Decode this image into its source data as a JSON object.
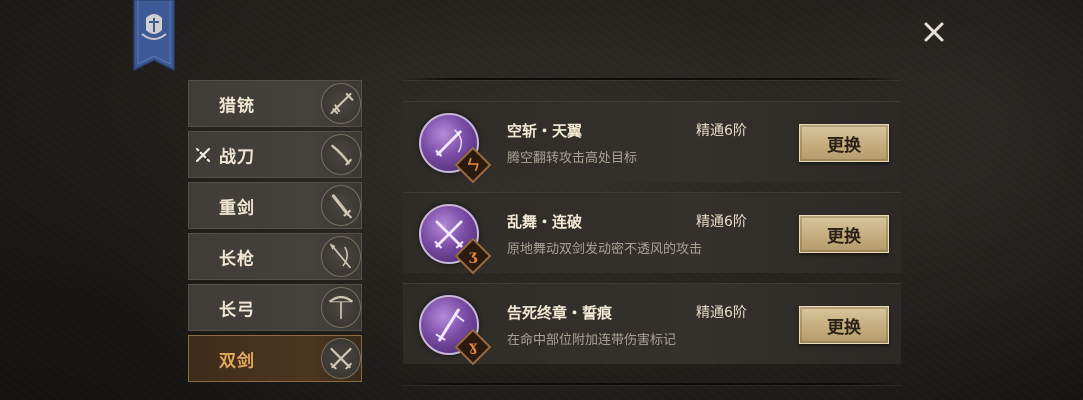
{
  "close": {
    "icon": "close-icon"
  },
  "banner": {
    "icon": "knight-helmet-banner-icon"
  },
  "weapons": [
    {
      "label": "猎铳",
      "icon": "musket-icon",
      "active": false
    },
    {
      "label": "战刀",
      "icon": "saber-icon",
      "active": false,
      "equipped_mark": "crossed-swords-mark-icon"
    },
    {
      "label": "重剑",
      "icon": "greatsword-icon",
      "active": false
    },
    {
      "label": "长枪",
      "icon": "spear-icon",
      "active": false
    },
    {
      "label": "长弓",
      "icon": "bow-icon",
      "active": false
    },
    {
      "label": "双剑",
      "icon": "dual-swords-icon",
      "active": true
    }
  ],
  "skills": [
    {
      "name": "空斩・天翼",
      "level": "精通6阶",
      "desc": "腾空翻转攻击高处目标",
      "badge": "ㄣ",
      "icon": "sword-slash-skill-icon",
      "button": "更换"
    },
    {
      "name": "乱舞・连破",
      "level": "精通6阶",
      "desc": "原地舞动双剑发动密不透风的攻击",
      "badge": "ʒ",
      "icon": "crossed-swords-skill-icon",
      "button": "更换"
    },
    {
      "name": "告死终章・誓痕",
      "level": "精通6阶",
      "desc": "在命中部位附加连带伤害标记",
      "badge": "ɣ",
      "icon": "sword-thrust-skill-icon",
      "button": "更换"
    }
  ],
  "colors": {
    "accent": "#e4a85a",
    "button": "#c5ad7d",
    "skill_orb": "#7a4ca6",
    "banner": "#3d5a96"
  }
}
